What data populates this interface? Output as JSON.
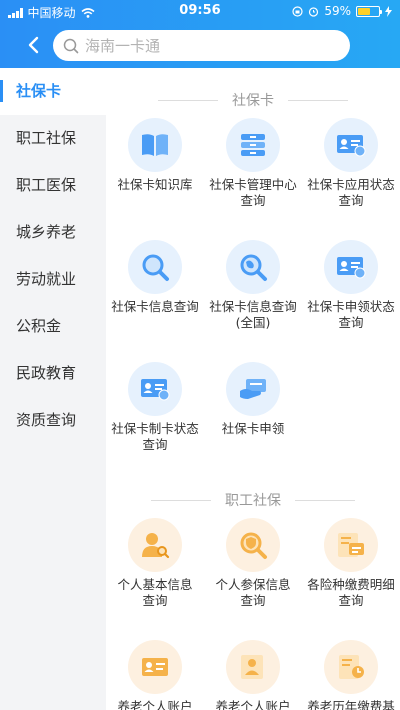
{
  "status_bar": {
    "carrier": "中国移动",
    "time": "09:56",
    "battery": "59%",
    "battery_level": 0.59
  },
  "header": {
    "search_placeholder": "海南一卡通"
  },
  "sidebar": {
    "items": [
      {
        "label": "社保卡",
        "active": true
      },
      {
        "label": "职工社保",
        "active": false
      },
      {
        "label": "职工医保",
        "active": false
      },
      {
        "label": "城乡养老",
        "active": false
      },
      {
        "label": "劳动就业",
        "active": false
      },
      {
        "label": "公积金",
        "active": false
      },
      {
        "label": "民政教育",
        "active": false
      },
      {
        "label": "资质查询",
        "active": false
      }
    ]
  },
  "sections": [
    {
      "title": "社保卡",
      "tiles": [
        {
          "label": "社保卡知识库",
          "icon": "book-icon"
        },
        {
          "label": "社保卡管理中心\n查询",
          "icon": "database-icon"
        },
        {
          "label": "社保卡应用状态\n查询",
          "icon": "id-card-icon"
        },
        {
          "label": "社保卡信息查询",
          "icon": "magnifier-icon"
        },
        {
          "label": "社保卡信息查询\n(全国)",
          "icon": "globe-search-icon"
        },
        {
          "label": "社保卡申领状态\n查询",
          "icon": "id-card-icon"
        },
        {
          "label": "社保卡制卡状态\n查询",
          "icon": "id-card-icon"
        },
        {
          "label": "社保卡申领",
          "icon": "card-hand-icon"
        }
      ]
    },
    {
      "title": "职工社保",
      "tiles": [
        {
          "label": "个人基本信息\n查询",
          "icon": "user-search-icon"
        },
        {
          "label": "个人参保信息\n查询",
          "icon": "shield-search-icon"
        },
        {
          "label": "各险种缴费明细\n查询",
          "icon": "payment-detail-icon"
        },
        {
          "label": "养老个人账户",
          "icon": "account-card-icon"
        },
        {
          "label": "养老个人账户",
          "icon": "account-user-icon"
        },
        {
          "label": "养老历年缴费基",
          "icon": "payment-history-icon"
        }
      ]
    }
  ],
  "colors": {
    "accent": "#2a8ff5",
    "blue_icon": "#4a9cf5",
    "orange_icon": "#f5b24a"
  }
}
